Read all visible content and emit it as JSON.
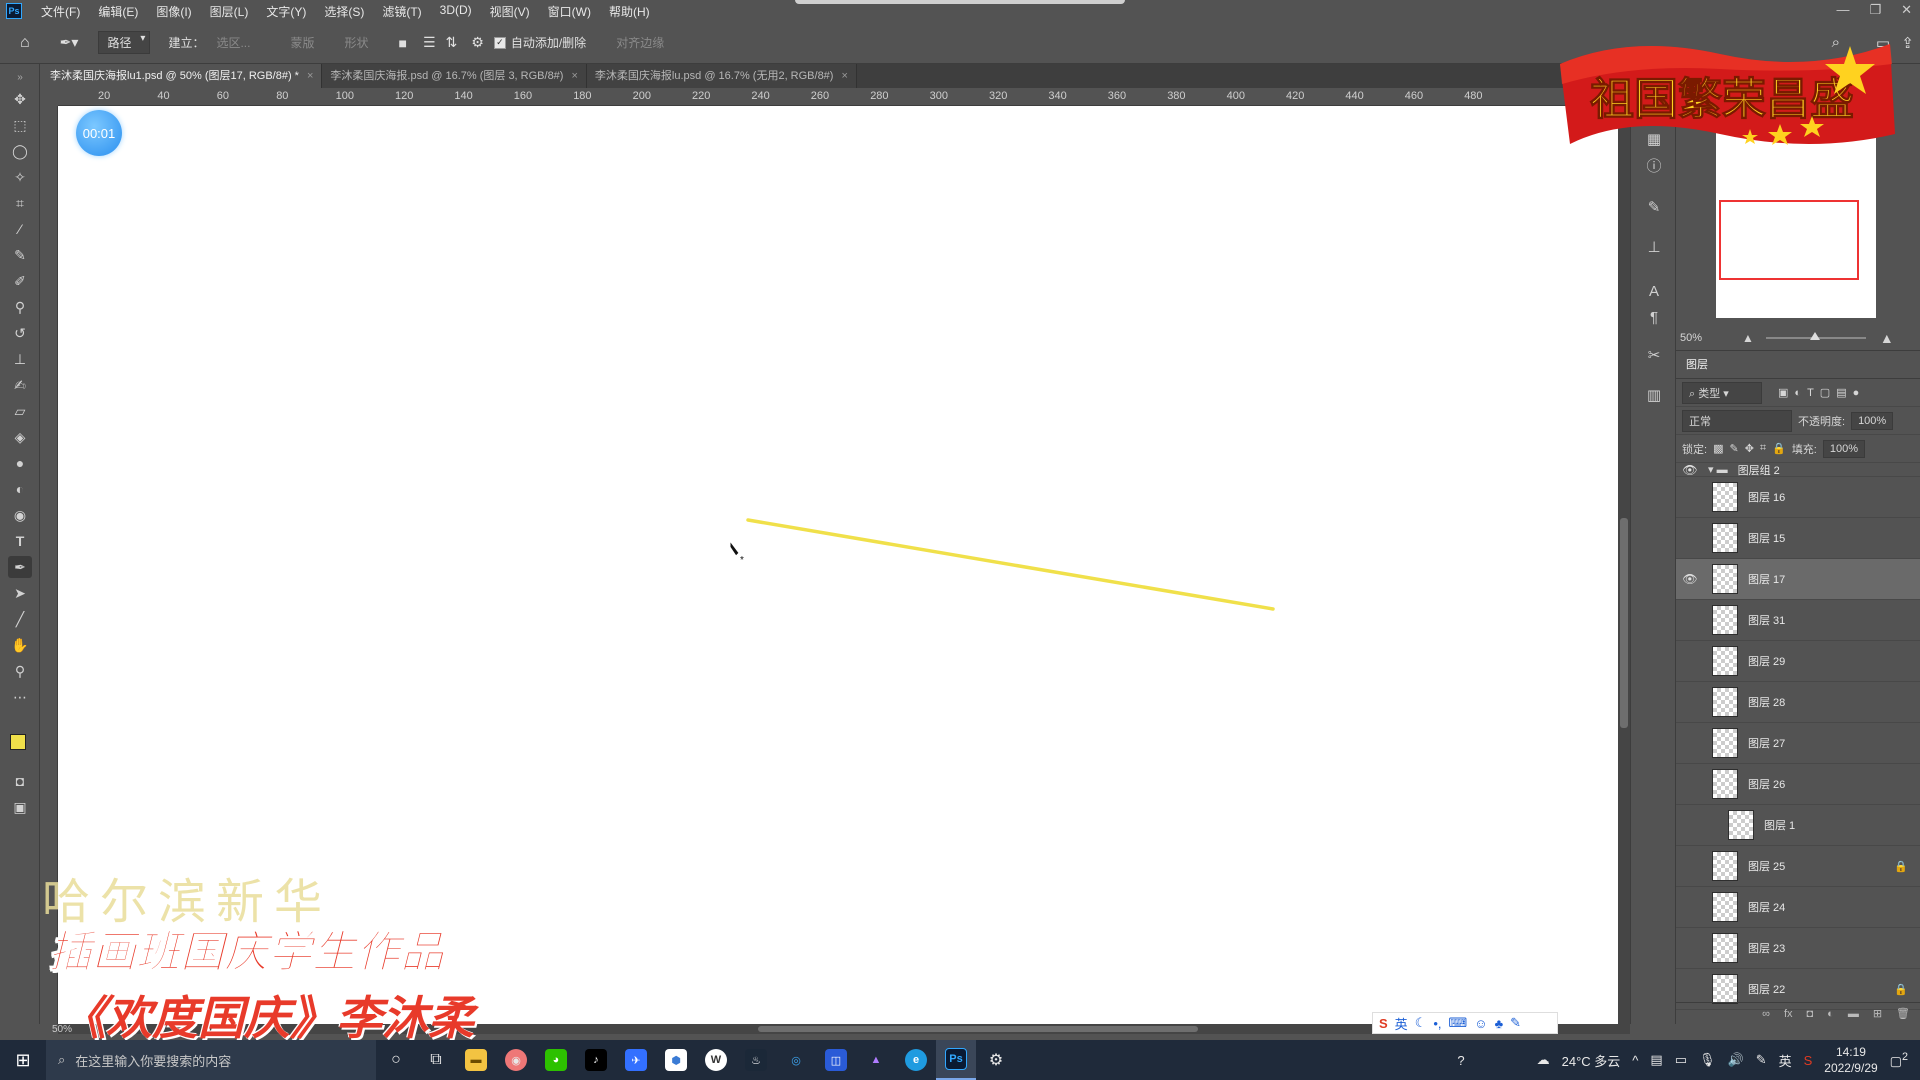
{
  "menubar": {
    "items": [
      "文件(F)",
      "编辑(E)",
      "图像(I)",
      "图层(L)",
      "文字(Y)",
      "选择(S)",
      "滤镜(T)",
      "3D(D)",
      "视图(V)",
      "窗口(W)",
      "帮助(H)"
    ]
  },
  "options": {
    "mode": "路径",
    "create_label": "建立：",
    "selection": "选区...",
    "mask": "蒙版",
    "shape": "形状",
    "auto_add_delete": "自动添加/删除",
    "align_edges": "对齐边缘"
  },
  "tabs": [
    "李沐柔国庆海报lu1.psd @ 50% (图层17, RGB/8#) *",
    "李沐柔国庆海报.psd @ 16.7% (图层 3, RGB/8#)",
    "李沐柔国庆海报lu.psd @ 16.7% (无用2, RGB/8#)"
  ],
  "ruler": {
    "ticks": [
      "20",
      "40",
      "60",
      "80",
      "100",
      "120",
      "140",
      "160",
      "180",
      "200",
      "220",
      "240",
      "260",
      "280",
      "300",
      "320",
      "340",
      "360",
      "380",
      "400",
      "420",
      "440",
      "460",
      "480"
    ]
  },
  "timer": "00:01",
  "canvas": {
    "stroke_color": "#f0e04a"
  },
  "navigator": {
    "zoom": "50%"
  },
  "layers": {
    "title": "图层",
    "filter": "类型",
    "blend": "正常",
    "opacity_label": "不透明度:",
    "opacity": "100%",
    "lock_label": "锁定:",
    "fill_label": "填充:",
    "fill": "100%",
    "group_name": "图层组 2",
    "items": [
      {
        "name": "图层 16",
        "visible": false,
        "selected": false,
        "locked": false
      },
      {
        "name": "图层 15",
        "visible": false,
        "selected": false,
        "locked": false
      },
      {
        "name": "图层 17",
        "visible": true,
        "selected": true,
        "locked": false
      },
      {
        "name": "图层 31",
        "visible": false,
        "selected": false,
        "locked": false
      },
      {
        "name": "图层 29",
        "visible": false,
        "selected": false,
        "locked": false
      },
      {
        "name": "图层 28",
        "visible": false,
        "selected": false,
        "locked": false
      },
      {
        "name": "图层 27",
        "visible": false,
        "selected": false,
        "locked": false
      },
      {
        "name": "图层 26",
        "visible": false,
        "selected": false,
        "locked": false
      },
      {
        "name": "图层 1",
        "visible": false,
        "selected": false,
        "locked": false,
        "clipped": true
      },
      {
        "name": "图层 25",
        "visible": false,
        "selected": false,
        "locked": true
      },
      {
        "name": "图层 24",
        "visible": false,
        "selected": false,
        "locked": false
      },
      {
        "name": "图层 23",
        "visible": false,
        "selected": false,
        "locked": false
      },
      {
        "name": "图层 22",
        "visible": false,
        "selected": false,
        "locked": true
      }
    ]
  },
  "status_zoom": "50%",
  "overlay": {
    "line1": "哈尔滨新华",
    "line2": "插画班国庆学生作品",
    "line3": "《欢度国庆》李沐柔",
    "flag_text": "祖国繁荣昌盛"
  },
  "taskbar": {
    "search_placeholder": "在这里输入你要搜索的内容",
    "weather": "24°C 多云",
    "ime": "英",
    "time": "14:19",
    "date": "2022/9/29",
    "notifications": "2"
  }
}
